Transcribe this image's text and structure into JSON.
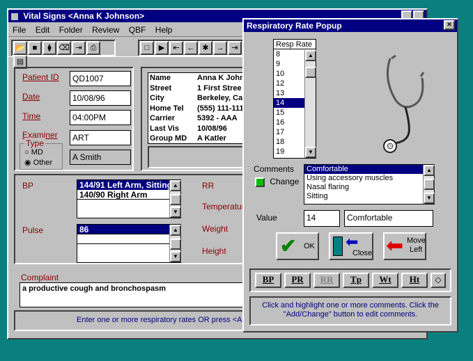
{
  "main_window": {
    "title": "Vital Signs <Anna K Johnson>",
    "menu": [
      "File",
      "Edit",
      "Folder",
      "Review",
      "QBF",
      "Help"
    ],
    "toolbar_left": [
      "open-icon",
      "save-icon",
      "tag-icon",
      "trash-icon",
      "import-icon",
      "print-icon",
      "chart-icon"
    ],
    "toolbar_right": [
      "query-icon",
      "play-icon",
      "first-icon",
      "prev-icon",
      "cross-icon",
      "next-icon",
      "last-icon"
    ]
  },
  "patient": {
    "id_label": "Patient ID",
    "id_value": "QD1007",
    "date_label": "Date",
    "date_value": "10/08/96",
    "time_label": "Time",
    "time_value": "04:00PM",
    "examiner_label": "Examiner",
    "examiner_value": "ART",
    "examiner_name": "A Smith",
    "type_label": "Type",
    "type_md": "MD",
    "type_other": "Other"
  },
  "info": {
    "rows": [
      {
        "k": "Name",
        "v": "Anna K John"
      },
      {
        "k": "Street",
        "v": "1 First Stree"
      },
      {
        "k": "City",
        "v": "Berkeley, Ca"
      },
      {
        "k": "Home Tel",
        "v": "(555) 111-111"
      },
      {
        "k": "Carrier",
        "v": "5392 - AAA"
      },
      {
        "k": "Last Vis",
        "v": "10/08/96"
      },
      {
        "k": "Group MD",
        "v": "A Katler"
      }
    ]
  },
  "vitals": {
    "bp_label": "BP",
    "bp_items": [
      "144/91 Left Arm, Sitting",
      "140/90 Right Arm"
    ],
    "pulse_label": "Pulse",
    "pulse_items": [
      "86"
    ],
    "rr_label": "RR",
    "temp_label": "Temperature",
    "weight_label": "Weight",
    "height_label": "Height"
  },
  "complaint": {
    "label": "Complaint",
    "text": "a productive cough and bronchospasm"
  },
  "status_text": "Enter one or more respiratory rates OR press <Alt-D",
  "popup": {
    "title": "Respiratory Rate Popup",
    "list_header": "Resp Rate",
    "rates": [
      "8",
      "9",
      "10",
      "12",
      "13",
      "14",
      "15",
      "16",
      "17",
      "18",
      "19"
    ],
    "selected_rate": "14",
    "comments_label": "Comments",
    "change_label": "Change",
    "comments": [
      "Comfortable",
      "Using accessory muscles",
      "Nasal flaring",
      "Sitting"
    ],
    "value_label": "Value",
    "value_number": "14",
    "value_text": "Comfortable",
    "ok_label": "OK",
    "close_label": "Close",
    "move_label_1": "Move",
    "move_label_2": "Left",
    "tabs": [
      "BP",
      "PR",
      "RR",
      "Tp",
      "Wt",
      "Ht"
    ],
    "help_text": "Click and highlight one or more comments. Click the \"Add/Change\" button to edit comments.",
    "colors": {
      "ok_check": "#008000",
      "close_arrow": "#0000c0",
      "move_arrow": "#e00000"
    }
  }
}
